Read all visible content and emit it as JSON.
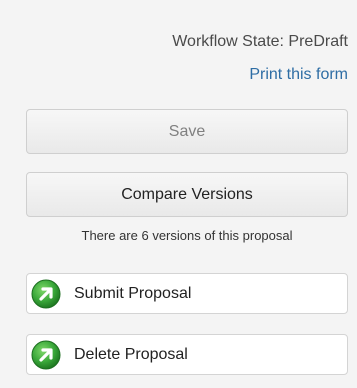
{
  "workflow": {
    "state_text": "Workflow State: PreDraft",
    "print_link": "Print this form"
  },
  "buttons": {
    "save_label": "Save",
    "compare_label": "Compare Versions"
  },
  "versions_note": "There are 6 versions of this proposal",
  "actions": {
    "submit_label": "Submit Proposal",
    "delete_label": "Delete Proposal",
    "icon": "green-arrow-up-right-icon"
  },
  "colors": {
    "background": "#f4f4f4",
    "link": "#2e6da4",
    "icon_green": "#3aa83a"
  }
}
